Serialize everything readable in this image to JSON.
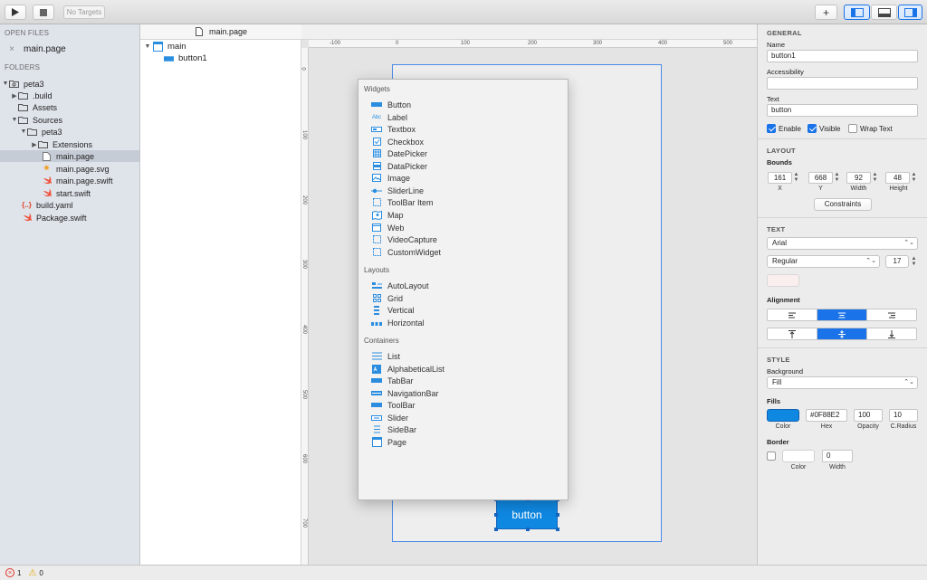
{
  "toolbar": {
    "run_icon": "play-icon",
    "stop_icon": "stop-icon",
    "targets_label": "No Targets",
    "add_label": "+",
    "layout_icons": [
      "left-panel-icon",
      "bottom-panel-icon",
      "right-panel-icon"
    ]
  },
  "left_panel": {
    "open_files_header": "OPEN FILES",
    "open_file": "main.page",
    "folders_header": "FOLDERS",
    "tree": [
      {
        "label": "peta3",
        "icon": "project-icon"
      },
      {
        "label": ".build",
        "icon": "folder-icon"
      },
      {
        "label": "Assets",
        "icon": "folder-icon"
      },
      {
        "label": "Sources",
        "icon": "folder-icon"
      },
      {
        "label": "peta3",
        "icon": "folder-icon"
      },
      {
        "label": "Extensions",
        "icon": "folder-icon"
      },
      {
        "label": "main.page",
        "icon": "file-icon"
      },
      {
        "label": "main.page.svg",
        "icon": "svg-file-icon"
      },
      {
        "label": "main.page.swift",
        "icon": "swift-icon"
      },
      {
        "label": "start.swift",
        "icon": "swift-icon"
      },
      {
        "label": "build.yaml",
        "icon": "yaml-icon"
      },
      {
        "label": "Package.swift",
        "icon": "swift-icon"
      }
    ]
  },
  "outline": {
    "tab_label": "main.page",
    "root": "main",
    "child": "button1"
  },
  "rulers": {
    "h_ticks": [
      "-100",
      "0",
      "100",
      "200",
      "300",
      "400",
      "500"
    ],
    "v_ticks": [
      "0",
      "100",
      "200",
      "300",
      "400",
      "500",
      "600",
      "700"
    ]
  },
  "canvas": {
    "button_label": "button"
  },
  "palette": {
    "widgets_header": "Widgets",
    "widgets": [
      "Button",
      "Label",
      "Textbox",
      "Checkbox",
      "DatePicker",
      "DataPicker",
      "Image",
      "SliderLine",
      "ToolBar Item",
      "Map",
      "Web",
      "VideoCapture",
      "CustomWidget"
    ],
    "layouts_header": "Layouts",
    "layouts": [
      "AutoLayout",
      "Grid",
      "Vertical",
      "Horizontal"
    ],
    "containers_header": "Containers",
    "containers": [
      "List",
      "AlphabeticalList",
      "TabBar",
      "NavigationBar",
      "ToolBar",
      "Slider",
      "SideBar",
      "Page"
    ]
  },
  "inspector": {
    "general_header": "GENERAL",
    "name_label": "Name",
    "name_value": "button1",
    "accessibility_label": "Accessibility",
    "accessibility_value": "",
    "text_label": "Text",
    "text_value": "button",
    "enable_label": "Enable",
    "visible_label": "Visible",
    "wrap_label": "Wrap Text",
    "layout_header": "LAYOUT",
    "bounds_label": "Bounds",
    "x_value": "161",
    "y_value": "668",
    "width_value": "92",
    "height_value": "48",
    "x_label": "X",
    "y_label": "Y",
    "width_label": "Width",
    "height_label": "Height",
    "constraints_label": "Constraints",
    "text_header": "TEXT",
    "font_value": "Arial",
    "weight_value": "Regular",
    "size_value": "17",
    "alignment_label": "Alignment",
    "style_header": "STYLE",
    "background_label": "Background",
    "background_value": "Fill",
    "fills_label": "Fills",
    "fill_color": "#0F88E2",
    "hex_value": "#0F88E2",
    "opacity_value": "100",
    "radius_value": "10",
    "color_label": "Color",
    "hex_label": "Hex",
    "opacity_label": "Opacity",
    "radius_label": "C.Radius",
    "border_label": "Border",
    "border_color_label": "Color",
    "border_width_value": "0",
    "border_width_label": "Width"
  },
  "status": {
    "errors": "1",
    "warnings": "0"
  }
}
